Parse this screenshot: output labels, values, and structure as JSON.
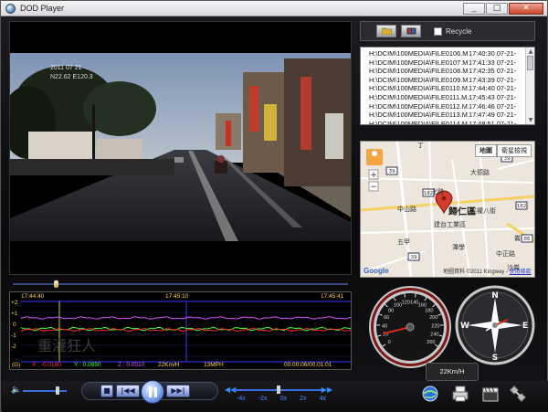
{
  "window": {
    "title": "DOD Player",
    "minimize": "_",
    "maximize": "□",
    "close": "✕"
  },
  "video": {
    "overlay_date": "2011 07 21",
    "overlay_coords": "N22.62 E120.3"
  },
  "toolbar": {
    "recycle_label": "Recycle",
    "recycle_checked": false
  },
  "files": [
    {
      "path": "H:\\DCIM\\100MEDIA\\FILE0106.M...",
      "time": "17:40:30 07-21-"
    },
    {
      "path": "H:\\DCIM\\100MEDIA\\FILE0107.M...",
      "time": "17:41:33 07-21-"
    },
    {
      "path": "H:\\DCIM\\100MEDIA\\FILE0108.M...",
      "time": "17:42:35 07-21-"
    },
    {
      "path": "H:\\DCIM\\100MEDIA\\FILE0109.M...",
      "time": "17:43:39 07-21-"
    },
    {
      "path": "H:\\DCIM\\100MEDIA\\FILE0110.M...",
      "time": "17:44:40 07-21-"
    },
    {
      "path": "H:\\DCIM\\100MEDIA\\FILE0111.M...",
      "time": "17:45:43 07-21-"
    },
    {
      "path": "H:\\DCIM\\100MEDIA\\FILE0112.M...",
      "time": "17:46:46 07-21-"
    },
    {
      "path": "H:\\DCIM\\100MEDIA\\FILE0113.M...",
      "time": "17:47:49 07-21-"
    },
    {
      "path": "H:\\DCIM\\100MEDIA\\FILE0114.M...",
      "time": "17:48:51 07-21-"
    },
    {
      "path": "H:\\DCIM\\100MEDIA\\FILE0115.M...",
      "time": "17:49:55 07-21-"
    }
  ],
  "map": {
    "tab_map": "地圖",
    "tab_satellite": "衛星檢視",
    "district": "歸仁區",
    "labels": [
      "丁",
      "大德路",
      "文化路",
      "中山路",
      "建台工業區",
      "民權八街",
      "潭學",
      "中正路",
      "崙",
      "沙崙",
      "五甲"
    ],
    "roads": [
      "182",
      "39",
      "39",
      "182",
      "39",
      "86"
    ],
    "attribution": "地圖資料 ©2011 Kingway - ",
    "terms_link": "使用條款",
    "logo": "Google"
  },
  "graph": {
    "time_start": "17:44:40",
    "time_mid": "17:45:10",
    "time_end": "17:45:41",
    "y_labels": [
      "+2",
      "+1",
      "0",
      "-1",
      "-2"
    ],
    "g_label": "(G)",
    "x_value": "X : -0.0180",
    "y_value": "Y : 0.0850",
    "z_value": "Z : 0.0510",
    "speed_kmh": "22Km/H",
    "speed_mph": "13MPH",
    "timecode": "00:00:06/00:01:01",
    "watermark": "重灌狂人"
  },
  "speedometer": {
    "ticks": [
      "0",
      "20",
      "40",
      "60",
      "80",
      "100",
      "120",
      "140",
      "160",
      "180",
      "200",
      "220",
      "240",
      "260"
    ],
    "value_kmh": 22
  },
  "compass": {
    "n": "N",
    "s": "S",
    "e": "E",
    "w": "W"
  },
  "speed_tag": "22Km/H",
  "transport": {
    "stop": "■",
    "prev": "|◀◀",
    "next": "▶▶|"
  },
  "rate": {
    "labels": [
      "-4x",
      "-2x",
      "0x",
      "2x",
      "4x"
    ]
  },
  "colors": {
    "accent": "#3a6ee0",
    "graph_x": "#ff2b2b",
    "graph_y": "#3cff3c",
    "graph_z": "#d64fff",
    "graph_text": "#ffd23a"
  }
}
